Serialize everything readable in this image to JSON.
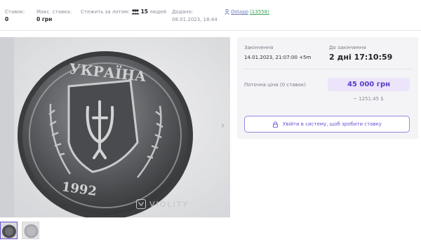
{
  "stats": {
    "bids_label": "Ставок:",
    "bids_value": "0",
    "max_bid_label": "Макс. ставка:",
    "max_bid_value": "0 грн",
    "watching_label": "Стежить за лотом:",
    "watching_count": "15",
    "watching_suffix": "людей",
    "added_label": "Додано:",
    "added_value": "08.01.2023, 18:44",
    "seller_name": "Ostapp",
    "seller_rating": "(13558)"
  },
  "gallery": {
    "watermark_text": "VIOLITY",
    "coin_legend": "УКРАЇНА",
    "coin_year": "1992",
    "next_arrow": "›"
  },
  "auction": {
    "end_label": "Закінчення",
    "end_value": "14.01.2023, 21:07:00 +5m",
    "remaining_label": "До закінчення",
    "remaining_value": "2 дні 17:10:59",
    "current_price_label": "Поточна ціна (0 ставок)",
    "current_price_value": "45 000 грн",
    "usd_value": "~ 1251.45 $",
    "login_button": "Увійти в систему, щоб зробити ставку"
  },
  "colors": {
    "accent": "#6c4fd1",
    "price_bg": "#ece4fb",
    "panel_bg": "#f4f4f7",
    "rating": "#3aa35a"
  }
}
